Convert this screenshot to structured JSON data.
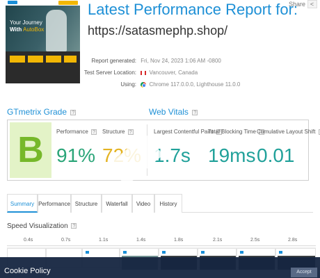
{
  "report": {
    "title": "Latest Performance Report for:",
    "url": "https://satasmephp.shop/",
    "share_label": "Share",
    "generated_label": "Report generated:",
    "generated_value": "Fri, Nov 24, 2023 1:06 AM -0800",
    "location_label": "Test Server Location:",
    "location_value": "Vancouver, Canada",
    "using_label": "Using:",
    "using_value": "Chrome 117.0.0.0, Lighthouse 11.0.0"
  },
  "thumbnail": {
    "headline_line1": "Your Journey",
    "headline_line2_prefix": "With",
    "headline_line2_brand": "AutoBox"
  },
  "gtmetrix_grade": {
    "heading": "GTmetrix Grade",
    "grade": "B",
    "performance_label": "Performance",
    "performance_value": "91%",
    "structure_label": "Structure",
    "structure_value": "72%"
  },
  "web_vitals": {
    "heading": "Web Vitals",
    "lcp_label": "Largest Contentful Paint",
    "lcp_value": "1.7s",
    "tbt_label": "Total Blocking Time",
    "tbt_value": "19ms",
    "cls_label": "Cumulative Layout Shift",
    "cls_value": "0.01"
  },
  "tabs": [
    "Summary",
    "Performance",
    "Structure",
    "Waterfall",
    "Video",
    "History"
  ],
  "speed_visualization": {
    "heading": "Speed Visualization",
    "ticks": [
      "0.4s",
      "0.7s",
      "1.1s",
      "1.4s",
      "1.8s",
      "2.1s",
      "2.5s",
      "2.8s"
    ]
  },
  "cookie": {
    "title": "Cookie Policy",
    "button": "Accept"
  },
  "colors": {
    "brand_blue": "#1e90d6",
    "grade_green": "#76b82a",
    "metric_green": "#2aa578",
    "metric_yellow": "#e4b322",
    "cookie_bg": "#152540"
  },
  "icons": [
    "help-icon",
    "share-icon",
    "canada-flag-icon",
    "chrome-icon"
  ]
}
